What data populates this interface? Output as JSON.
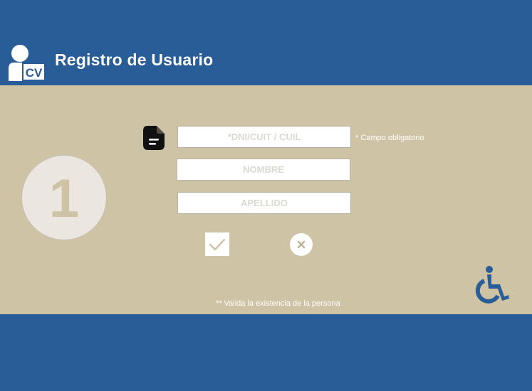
{
  "header": {
    "title": "Registro de Usuario",
    "logo_text": "CV",
    "logo_icon": "user-cv-icon"
  },
  "step": {
    "number": "1"
  },
  "form": {
    "dni_placeholder": "*DNI/CUIT / CUIL",
    "dni_value": "",
    "nombre_placeholder": "NOMBRE",
    "nombre_value": "",
    "apellido_placeholder": "APELLIDO",
    "apellido_value": "",
    "required_note": "* Campo obligatorio",
    "validate_note": "** Valida la existencia de la persona"
  },
  "actions": {
    "confirm_icon": "check-icon",
    "cancel_icon": "close-icon"
  },
  "accessibility": {
    "icon": "wheelchair-icon"
  },
  "colors": {
    "brand_blue": "#285d97",
    "panel_beige": "#cfc3a5",
    "white": "#ffffff",
    "circle_fill": "#ebe6e0"
  }
}
